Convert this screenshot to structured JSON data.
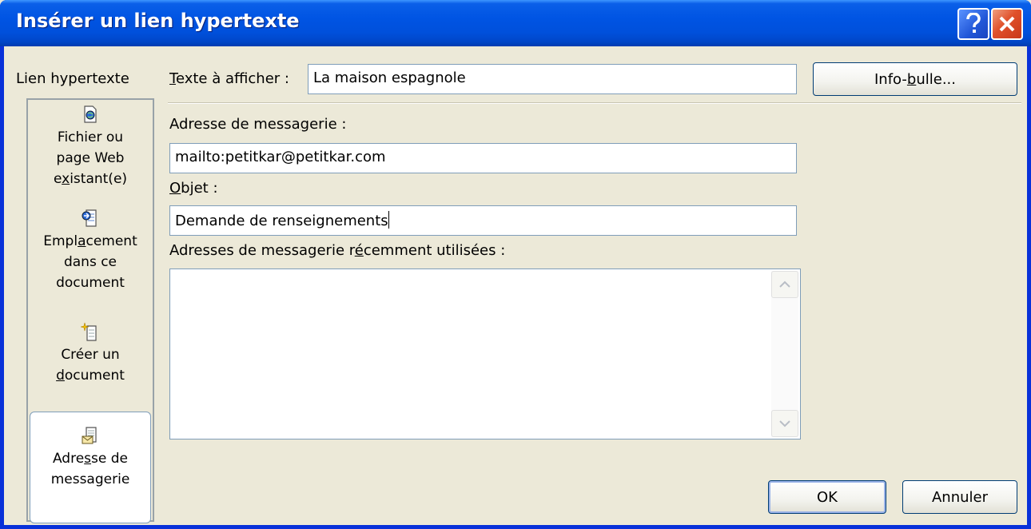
{
  "window": {
    "title": "Insérer un lien hypertexte"
  },
  "sidebar": {
    "heading": "Lien hypertexte",
    "items": [
      {
        "label_lines": [
          "Fichier ou",
          "page Web",
          "existant(e)"
        ],
        "icon": "file-web-icon"
      },
      {
        "label_lines": [
          "Emplacement",
          "dans ce",
          "document"
        ],
        "icon": "document-place-icon"
      },
      {
        "label_lines": [
          "Créer un",
          "document"
        ],
        "icon": "new-document-icon"
      },
      {
        "label_lines": [
          "Adresse de",
          "messagerie"
        ],
        "icon": "email-address-icon",
        "selected": true
      }
    ]
  },
  "form": {
    "display_text_label": "Texte à afficher :",
    "display_text_value": "La maison espagnole",
    "tooltip_button": "Info-bulle...",
    "email_label": "Adresse de messagerie :",
    "email_value": "mailto:petitkar@petitkar.com",
    "subject_label": "Objet :",
    "subject_value": "Demande de renseignements",
    "recent_label": "Adresses de messagerie récemment utilisées :"
  },
  "footer": {
    "ok_label": "OK",
    "cancel_label": "Annuler"
  }
}
